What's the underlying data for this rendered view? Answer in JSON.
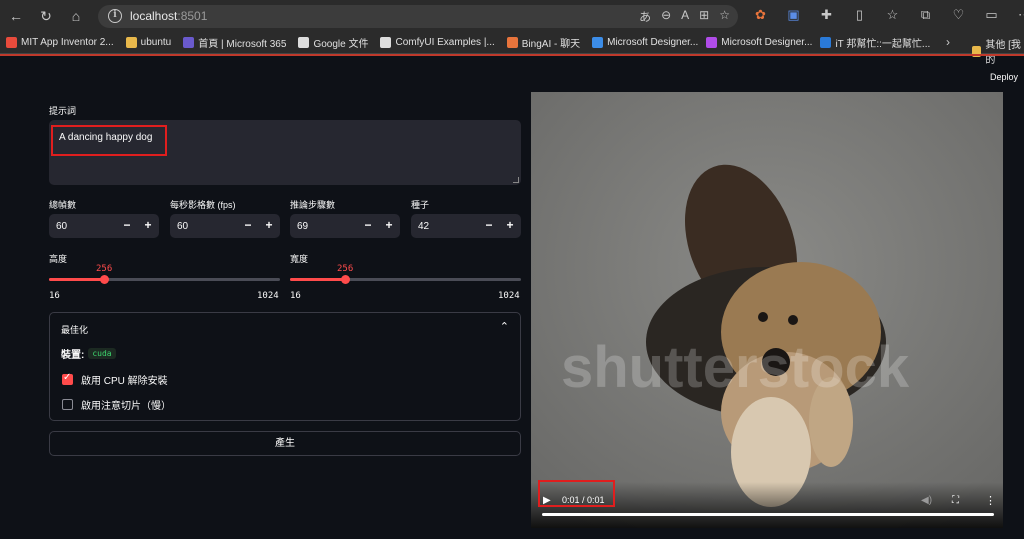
{
  "browser": {
    "url_host": "localhost",
    "url_port": ":8501"
  },
  "bookmarks": [
    {
      "label": "MIT App Inventor 2...",
      "color": "#e84b3c"
    },
    {
      "label": "ubuntu",
      "color": "#e8b84b"
    },
    {
      "label": "首頁 | Microsoft 365",
      "color": "#6a5acd"
    },
    {
      "label": "Google 文件",
      "color": "#dddddd"
    },
    {
      "label": "ComfyUI Examples |...",
      "color": "#dddddd"
    },
    {
      "label": "BingAI - 聊天",
      "color": "#e8743c"
    },
    {
      "label": "Microsoft Designer...",
      "color": "#3c8de8"
    },
    {
      "label": "Microsoft Designer...",
      "color": "#b04ce8"
    },
    {
      "label": "iT 邦幫忙::一起幫忙...",
      "color": "#2a7ad8"
    }
  ],
  "bookmarks_other": "其他 [我的",
  "app": {
    "deploy_label": "Deploy",
    "prompt_label": "提示詞",
    "prompt_value": "A dancing happy dog",
    "frames_label": "總幀數",
    "frames_value": "60",
    "fps_label": "每秒影格數 (fps)",
    "fps_value": "60",
    "steps_label": "推論步驟數",
    "steps_value": "69",
    "seed_label": "種子",
    "seed_value": "42",
    "minus": "−",
    "plus": "+",
    "height_label": "高度",
    "height_value": "256",
    "height_min": "16",
    "height_max": "1024",
    "width_label": "寬度",
    "width_value": "256",
    "width_min": "16",
    "width_max": "1024",
    "optimize_title": "最佳化",
    "device_label": "裝置:",
    "device_value": "cuda",
    "cpu_offload_label": "啟用 CPU 解除安裝",
    "cpu_offload_checked": true,
    "attention_slicing_label": "啟用注意切片（慢）",
    "attention_slicing_checked": false,
    "generate_label": "產生"
  },
  "video": {
    "time": "0:01 / 0:01",
    "watermark": "shutterstock",
    "progress": 1.0
  },
  "colors": {
    "accent": "#ff4b4b",
    "background": "#0e1117",
    "input_bg": "#262730"
  }
}
